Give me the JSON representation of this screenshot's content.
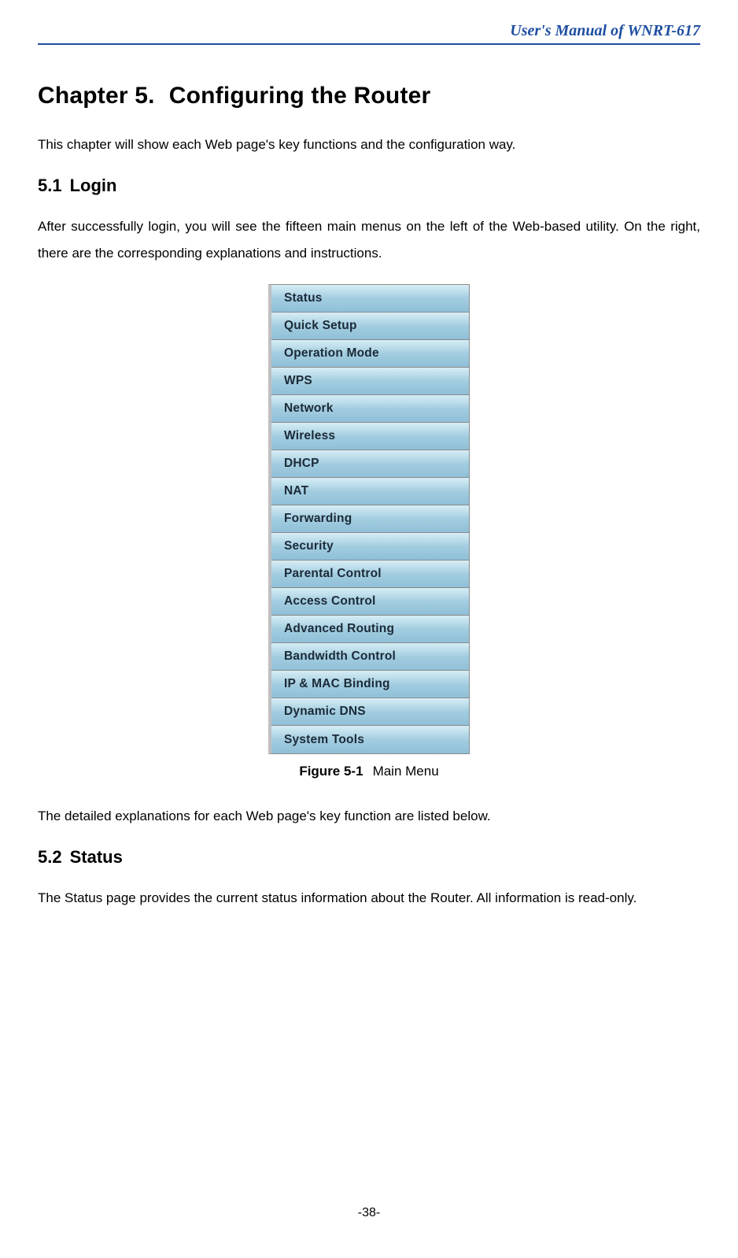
{
  "header": {
    "title": "User's Manual of WNRT-617"
  },
  "chapter": {
    "number": "Chapter 5.",
    "title": "Configuring the Router",
    "intro": "This chapter will show each Web page's key functions and the configuration way."
  },
  "section_login": {
    "number": "5.1",
    "title": "Login",
    "body": "After successfully login, you will see the fifteen main menus on the left of the Web-based utility. On the right, there are the corresponding explanations and instructions."
  },
  "menu_items": [
    "Status",
    "Quick Setup",
    "Operation Mode",
    "WPS",
    "Network",
    "Wireless",
    "DHCP",
    "NAT",
    "Forwarding",
    "Security",
    "Parental Control",
    "Access Control",
    "Advanced Routing",
    "Bandwidth Control",
    "IP & MAC Binding",
    "Dynamic DNS",
    "System Tools"
  ],
  "figure": {
    "label": "Figure 5-1",
    "caption": "Main Menu"
  },
  "after_figure": "The detailed explanations for each Web page's key function are listed below.",
  "section_status": {
    "number": "5.2",
    "title": "Status",
    "body": "The Status page provides the current status information about the Router. All information is read-only."
  },
  "page_number": "-38-"
}
